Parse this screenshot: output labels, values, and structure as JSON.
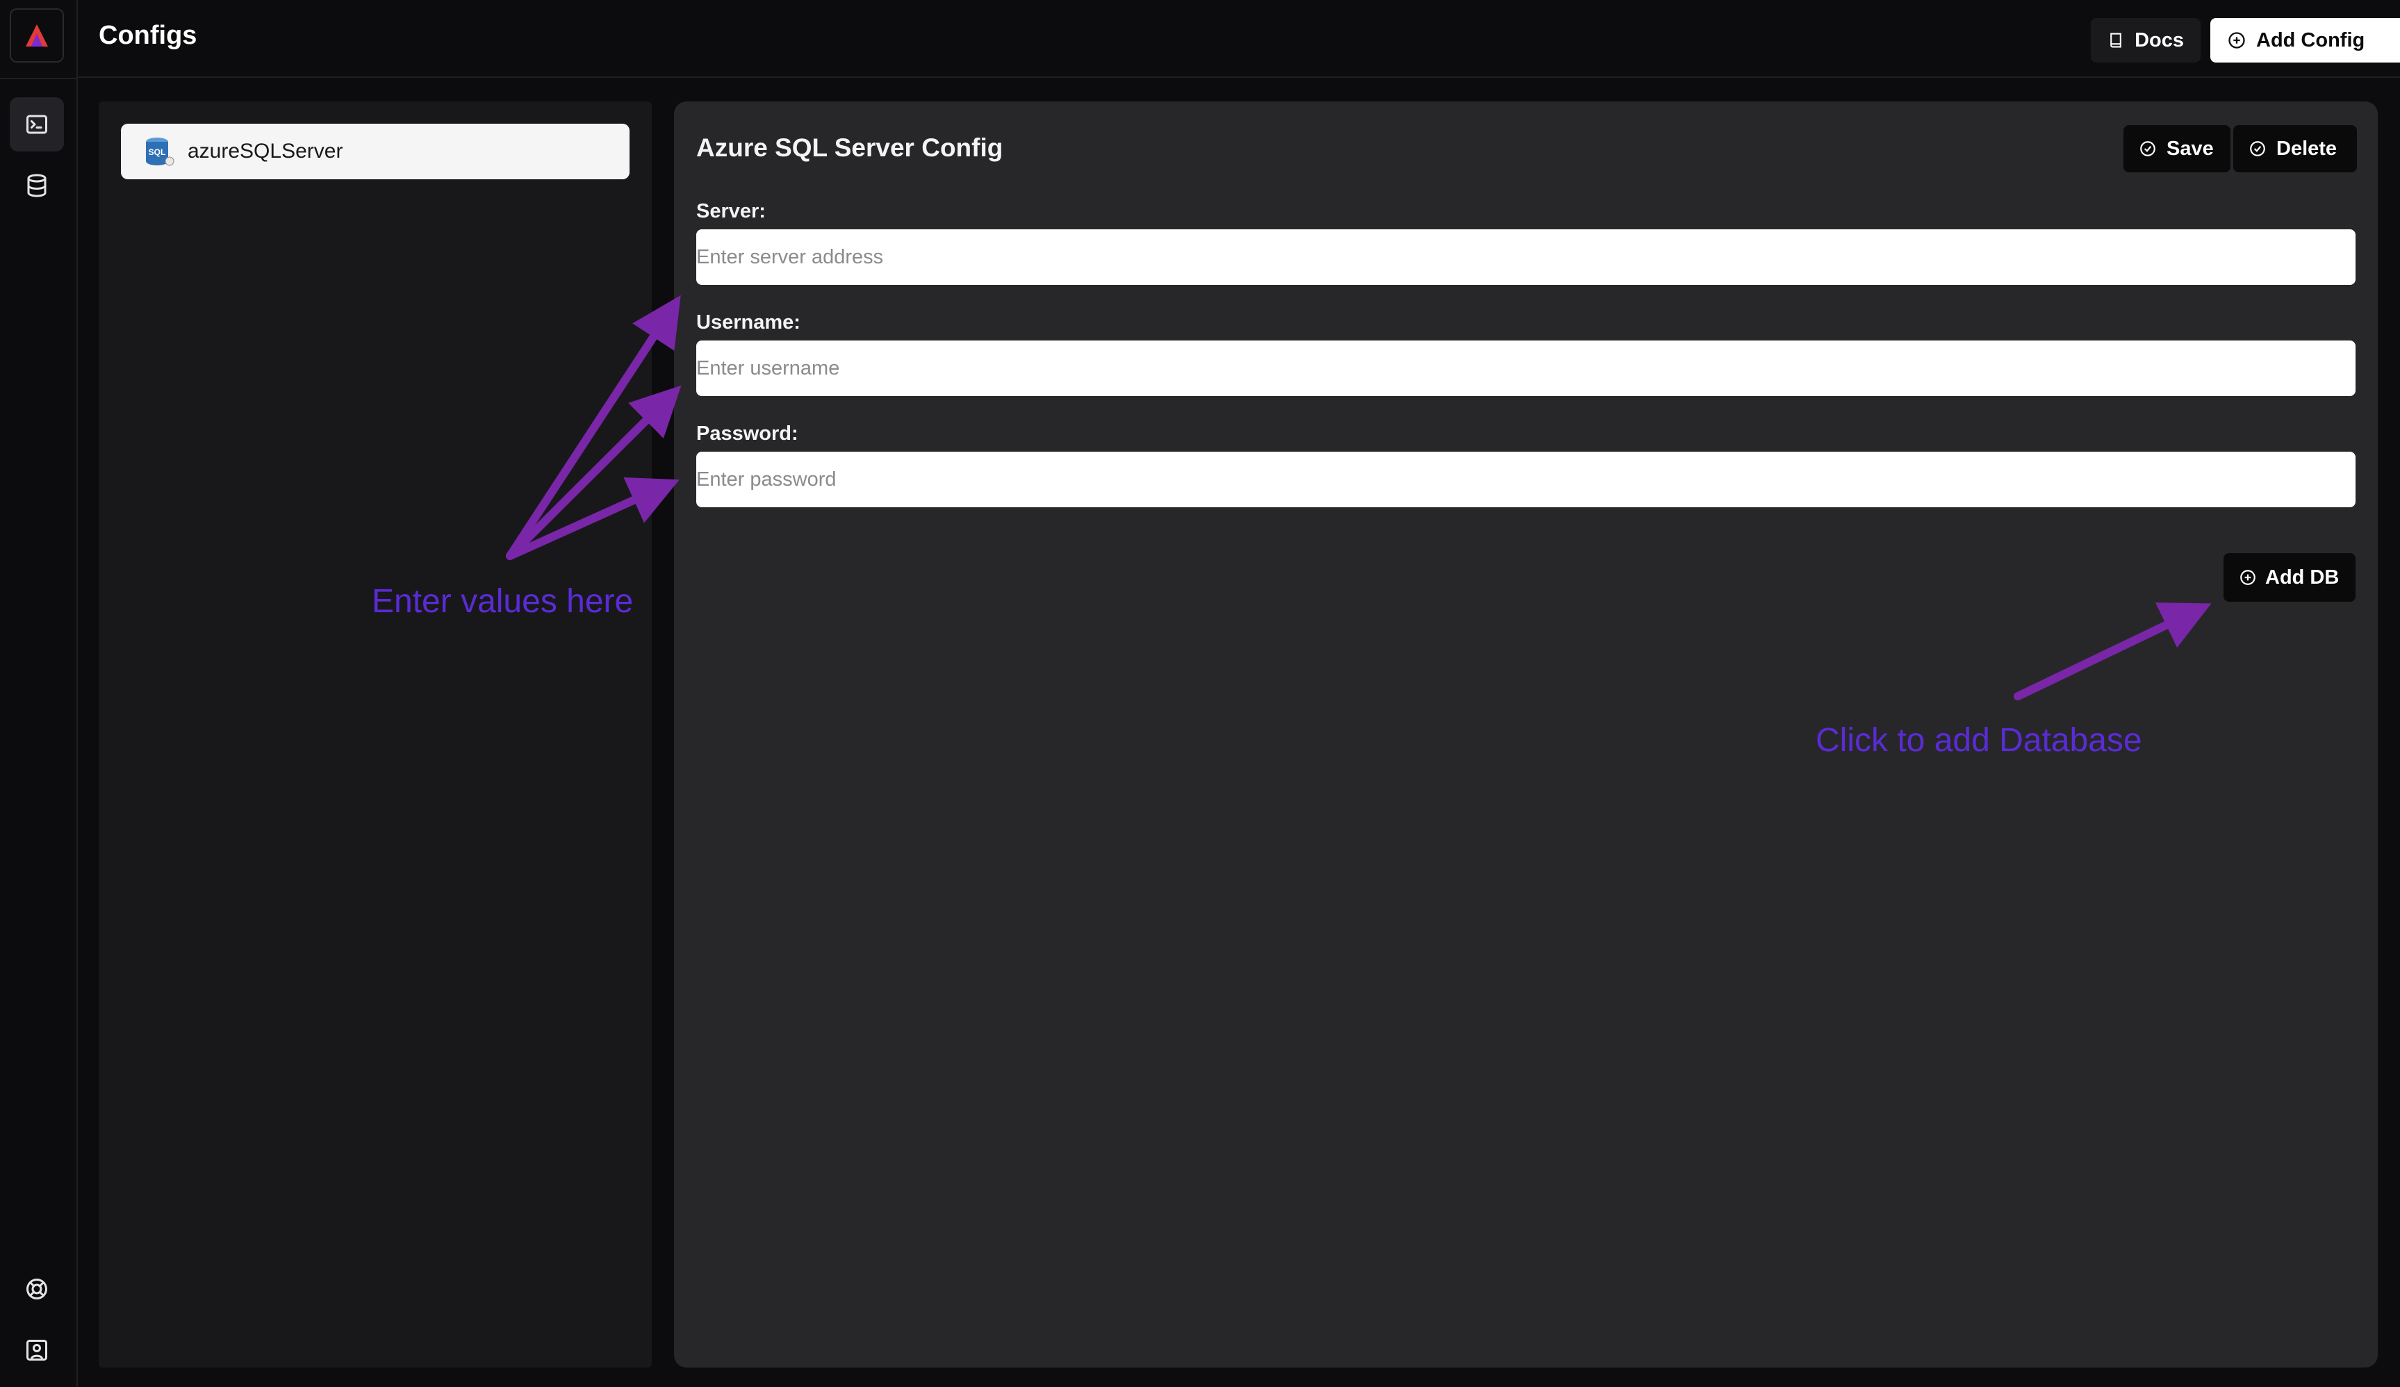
{
  "header": {
    "title": "Configs",
    "docs_label": "Docs",
    "add_config_label": "Add Config"
  },
  "rail": {
    "items": [
      {
        "icon": "terminal-icon",
        "active": true
      },
      {
        "icon": "database-icon",
        "active": false
      }
    ],
    "bottom_items": [
      {
        "icon": "help-lifebuoy-icon"
      },
      {
        "icon": "user-profile-icon"
      }
    ]
  },
  "config_list": {
    "items": [
      {
        "label": "azureSQLServer",
        "icon": "sql-server-icon"
      }
    ]
  },
  "config_panel": {
    "title": "Azure SQL Server Config",
    "save_label": "Save",
    "delete_label": "Delete",
    "fields": [
      {
        "label": "Server:",
        "placeholder": "Enter server address",
        "value": ""
      },
      {
        "label": "Username:",
        "placeholder": "Enter username",
        "value": ""
      },
      {
        "label": "Password:",
        "placeholder": "Enter password",
        "value": ""
      }
    ],
    "add_db_label": "Add DB"
  },
  "annotations": {
    "enter_values": "Enter values here",
    "add_database": "Click to add Database",
    "color": "#5b2bd6",
    "arrow_color": "#7a26a8"
  },
  "colors": {
    "background": "#0c0c0e",
    "panel": "#27272a",
    "list_panel": "#18181b"
  }
}
